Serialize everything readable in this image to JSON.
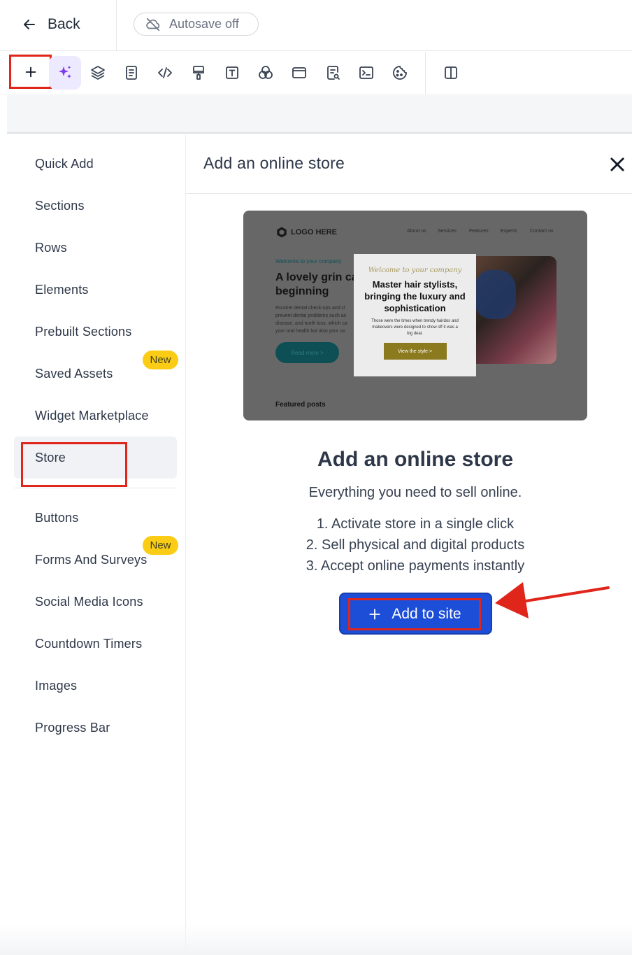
{
  "topbar": {
    "back_label": "Back",
    "autosave_label": "Autosave off"
  },
  "toolbar": {
    "tools": [
      "plus-icon",
      "sparkles-icon",
      "layers-icon",
      "page-icon",
      "code-icon",
      "paint-roller-icon",
      "text-icon",
      "color-circles-icon",
      "window-icon",
      "page-search-icon",
      "terminal-icon",
      "cookie-icon",
      "split-view-icon"
    ]
  },
  "sidebar": {
    "items": [
      {
        "label": "Quick Add"
      },
      {
        "label": "Sections"
      },
      {
        "label": "Rows"
      },
      {
        "label": "Elements"
      },
      {
        "label": "Prebuilt Sections"
      },
      {
        "label": "Saved Assets",
        "badge": "New"
      },
      {
        "label": "Widget Marketplace"
      },
      {
        "label": "Store",
        "selected": true
      },
      {
        "label": "Buttons"
      },
      {
        "label": "Forms And Surveys",
        "badge": "New"
      },
      {
        "label": "Social Media Icons"
      },
      {
        "label": "Countdown Timers"
      },
      {
        "label": "Images"
      },
      {
        "label": "Progress Bar"
      }
    ]
  },
  "panel": {
    "title": "Add an online store",
    "preview": {
      "logo": "LOGO HERE",
      "nav": [
        "About us",
        "Services",
        "Features",
        "Experts",
        "Contact us"
      ],
      "welcome": "Welcome to your company",
      "heading": "A lovely grin ca beginning",
      "body": "Routine dental check-ups and cl prevent dental problems such as disease, and tooth loss, which ca your oral health but also your ov",
      "read_more": "Read more  >",
      "card_script": "Welcome to your company",
      "card_title": "Master hair stylists, bringing the luxury and sophistication",
      "card_text": "Those were the times when trendy hairdos and makeovers were designed to show off it was a big deal.",
      "card_button": "View the style  >",
      "featured": "Featured posts"
    },
    "store_heading": "Add an online store",
    "store_sub": "Everything you need to sell online.",
    "features": [
      "1. Activate store in a single click",
      "2. Sell physical and digital products",
      "3. Accept online payments instantly"
    ],
    "add_button": "Add to site"
  },
  "colors": {
    "accent_blue": "#1d4ed8",
    "highlight_red": "#e0251b",
    "badge_yellow": "#facc15",
    "ai_purple": "#7c3aed"
  }
}
